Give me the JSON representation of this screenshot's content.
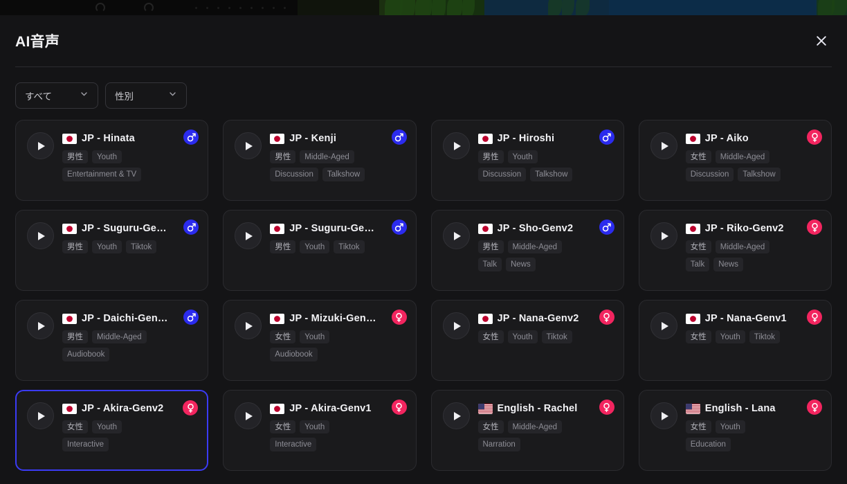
{
  "backdrop": {
    "description": "app-canvas-behind-modal"
  },
  "header": {
    "title": "AI音声",
    "close_icon": "close-icon"
  },
  "filters": [
    {
      "name": "category",
      "label": "すべて",
      "icon": "chevron-down-icon"
    },
    {
      "name": "gender",
      "label": "性別",
      "icon": "chevron-down-icon"
    }
  ],
  "colors": {
    "modal_bg": "#141416",
    "card_bg": "#1a1a1c",
    "card_border": "#2b2b2f",
    "selected_border": "#3b3bf5",
    "male_badge": "#2b2bee",
    "female_badge": "#f2255f",
    "tag_bg": "#252529",
    "text_primary": "#f3f3f6",
    "text_muted": "#8e8e96"
  },
  "voices": [
    {
      "name": "JP - Hinata",
      "flag": "jp-flag-icon",
      "gender": "male",
      "gender_icon": "male-icon",
      "selected": false,
      "tag_rows": [
        [
          "男性",
          "Youth"
        ],
        [
          "Entertainment & TV"
        ]
      ]
    },
    {
      "name": "JP - Kenji",
      "flag": "jp-flag-icon",
      "gender": "male",
      "gender_icon": "male-icon",
      "selected": false,
      "tag_rows": [
        [
          "男性",
          "Middle-Aged"
        ],
        [
          "Discussion",
          "Talkshow"
        ]
      ]
    },
    {
      "name": "JP - Hiroshi",
      "flag": "jp-flag-icon",
      "gender": "male",
      "gender_icon": "male-icon",
      "selected": false,
      "tag_rows": [
        [
          "男性",
          "Youth"
        ],
        [
          "Discussion",
          "Talkshow"
        ]
      ]
    },
    {
      "name": "JP - Aiko",
      "flag": "jp-flag-icon",
      "gender": "female",
      "gender_icon": "female-icon",
      "selected": false,
      "tag_rows": [
        [
          "女性",
          "Middle-Aged"
        ],
        [
          "Discussion",
          "Talkshow"
        ]
      ]
    },
    {
      "name": "JP - Suguru-Ge…",
      "flag": "jp-flag-icon",
      "gender": "male",
      "gender_icon": "male-icon",
      "selected": false,
      "tag_rows": [
        [
          "男性",
          "Youth",
          "Tiktok"
        ]
      ]
    },
    {
      "name": "JP - Suguru-Ge…",
      "flag": "jp-flag-icon",
      "gender": "male",
      "gender_icon": "male-icon",
      "selected": false,
      "tag_rows": [
        [
          "男性",
          "Youth",
          "Tiktok"
        ]
      ]
    },
    {
      "name": "JP - Sho-Genv2",
      "flag": "jp-flag-icon",
      "gender": "male",
      "gender_icon": "male-icon",
      "selected": false,
      "tag_rows": [
        [
          "男性",
          "Middle-Aged"
        ],
        [
          "Talk",
          "News"
        ]
      ]
    },
    {
      "name": "JP - Riko-Genv2",
      "flag": "jp-flag-icon",
      "gender": "female",
      "gender_icon": "female-icon",
      "selected": false,
      "tag_rows": [
        [
          "女性",
          "Middle-Aged"
        ],
        [
          "Talk",
          "News"
        ]
      ]
    },
    {
      "name": "JP - Daichi-Gen…",
      "flag": "jp-flag-icon",
      "gender": "male",
      "gender_icon": "male-icon",
      "selected": false,
      "tag_rows": [
        [
          "男性",
          "Middle-Aged"
        ],
        [
          "Audiobook"
        ]
      ]
    },
    {
      "name": "JP - Mizuki-Gen…",
      "flag": "jp-flag-icon",
      "gender": "female",
      "gender_icon": "female-icon",
      "selected": false,
      "tag_rows": [
        [
          "女性",
          "Youth"
        ],
        [
          "Audiobook"
        ]
      ]
    },
    {
      "name": "JP - Nana-Genv2",
      "flag": "jp-flag-icon",
      "gender": "female",
      "gender_icon": "female-icon",
      "selected": false,
      "tag_rows": [
        [
          "女性",
          "Youth",
          "Tiktok"
        ]
      ]
    },
    {
      "name": "JP - Nana-Genv1",
      "flag": "jp-flag-icon",
      "gender": "female",
      "gender_icon": "female-icon",
      "selected": false,
      "tag_rows": [
        [
          "女性",
          "Youth",
          "Tiktok"
        ]
      ]
    },
    {
      "name": "JP - Akira-Genv2",
      "flag": "jp-flag-icon",
      "gender": "female",
      "gender_icon": "female-icon",
      "selected": true,
      "tag_rows": [
        [
          "女性",
          "Youth"
        ],
        [
          "Interactive"
        ]
      ]
    },
    {
      "name": "JP - Akira-Genv1",
      "flag": "jp-flag-icon",
      "gender": "female",
      "gender_icon": "female-icon",
      "selected": false,
      "tag_rows": [
        [
          "女性",
          "Youth"
        ],
        [
          "Interactive"
        ]
      ]
    },
    {
      "name": "English - Rachel",
      "flag": "us-flag-icon",
      "gender": "female",
      "gender_icon": "female-icon",
      "selected": false,
      "tag_rows": [
        [
          "女性",
          "Middle-Aged"
        ],
        [
          "Narration"
        ]
      ]
    },
    {
      "name": "English - Lana",
      "flag": "us-flag-icon",
      "gender": "female",
      "gender_icon": "female-icon",
      "selected": false,
      "tag_rows": [
        [
          "女性",
          "Youth"
        ],
        [
          "Education"
        ]
      ]
    }
  ]
}
